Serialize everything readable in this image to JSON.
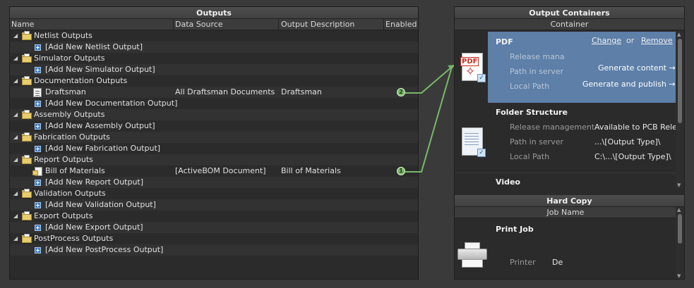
{
  "outputs": {
    "title": "Outputs",
    "columns": {
      "name": "Name",
      "data_source": "Data Source",
      "output_description": "Output Description",
      "enabled": "Enabled"
    },
    "rows": [
      {
        "kind": "group",
        "name": "Netlist Outputs"
      },
      {
        "kind": "add",
        "name": "[Add New Netlist Output]"
      },
      {
        "kind": "group",
        "name": "Simulator Outputs"
      },
      {
        "kind": "add",
        "name": "[Add New Simulator Output]"
      },
      {
        "kind": "group",
        "name": "Documentation Outputs"
      },
      {
        "kind": "item",
        "name": "Draftsman",
        "data_source": "All Draftsman Documents",
        "description": "Draftsman",
        "enabled": "2"
      },
      {
        "kind": "add",
        "name": "[Add New Documentation Output]"
      },
      {
        "kind": "group",
        "name": "Assembly Outputs"
      },
      {
        "kind": "add",
        "name": "[Add New Assembly Output]"
      },
      {
        "kind": "group",
        "name": "Fabrication Outputs"
      },
      {
        "kind": "add",
        "name": "[Add New Fabrication Output]"
      },
      {
        "kind": "group",
        "name": "Report Outputs"
      },
      {
        "kind": "item",
        "name": "Bill of Materials",
        "data_source": "[ActiveBOM Document]",
        "description": "Bill of Materials",
        "enabled": "1"
      },
      {
        "kind": "add",
        "name": "[Add New Report Output]"
      },
      {
        "kind": "group",
        "name": "Validation Outputs"
      },
      {
        "kind": "add",
        "name": "[Add New Validation Output]"
      },
      {
        "kind": "group",
        "name": "Export Outputs"
      },
      {
        "kind": "add",
        "name": "[Add New Export Output]"
      },
      {
        "kind": "group",
        "name": "PostProcess Outputs"
      },
      {
        "kind": "add",
        "name": "[Add New PostProcess Output]"
      }
    ]
  },
  "output_containers": {
    "title": "Output Containers",
    "subheader": "Container",
    "pdf": {
      "title": "PDF",
      "change": "Change",
      "or": "or",
      "remove": "Remove",
      "release_label": "Release mana",
      "path_label": "Path in server",
      "local_label": "Local Path",
      "generate_content": "Generate content →",
      "generate_publish": "Generate and publish →"
    },
    "folder_structure": {
      "title": "Folder Structure",
      "release_label": "Release management",
      "release_value": "Available to PCB Relea",
      "path_label": "Path in server",
      "path_value": "...\\[Output Type]\\",
      "local_label": "Local Path",
      "local_value": "C:\\...\\[Output Type]\\"
    },
    "video": {
      "title": "Video"
    }
  },
  "hard_copy": {
    "title": "Hard Copy",
    "subheader": "Job Name",
    "print_job": {
      "title": "Print Job",
      "printer_label": "Printer",
      "printer_value": "De"
    }
  },
  "colors": {
    "accent_card": "#5d7fa8",
    "connector": "#7ab86a"
  }
}
